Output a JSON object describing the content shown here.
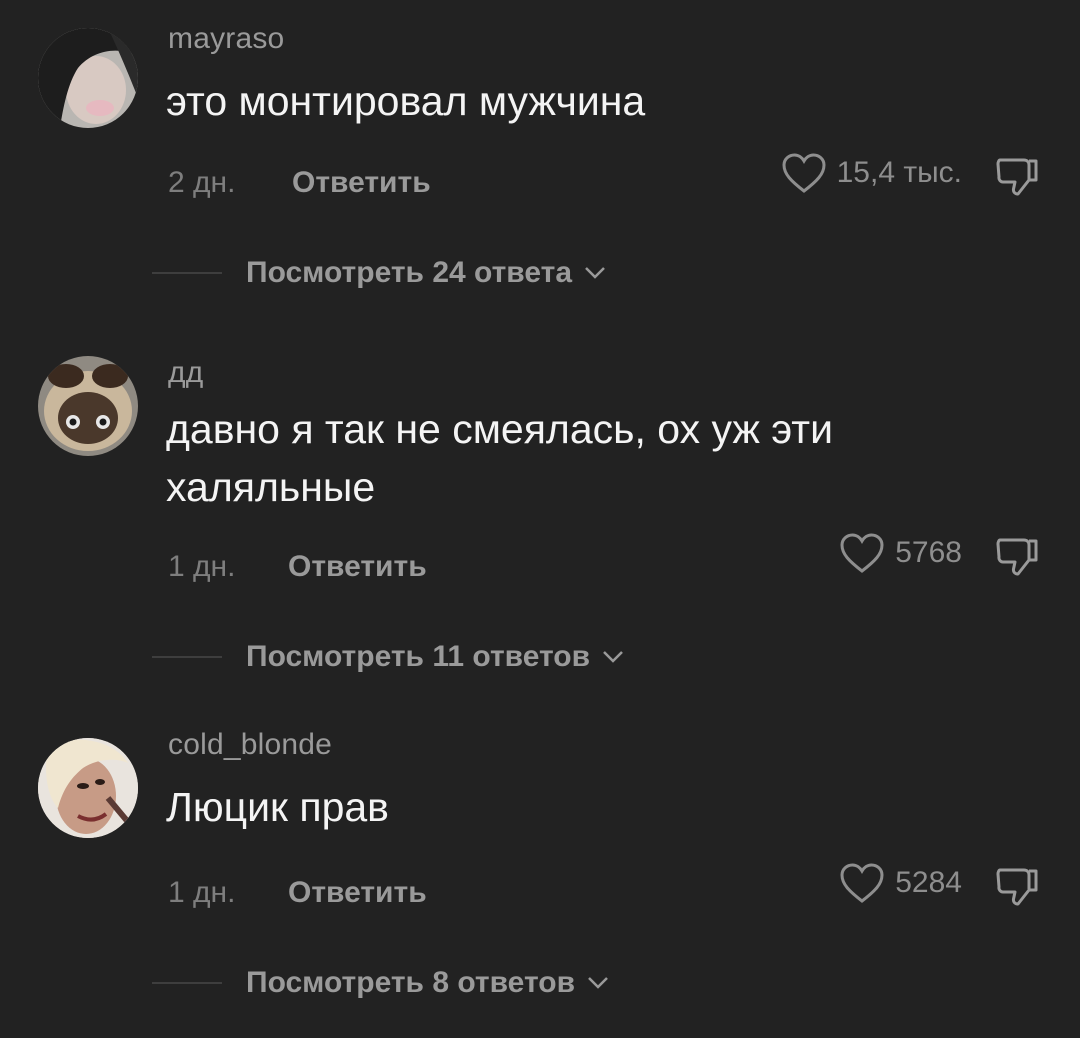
{
  "comments": [
    {
      "username": "mayraso",
      "text": "это монтировал мужчина",
      "time": "2 дн.",
      "reply_label": "Ответить",
      "likes": "15,4 тыс.",
      "view_replies": "Посмотреть 24 ответа"
    },
    {
      "username": "дд",
      "text": "давно я так не смеялась, ох уж эти халяльные",
      "time": "1 дн.",
      "reply_label": "Ответить",
      "likes": "5768",
      "view_replies": "Посмотреть 11 ответов"
    },
    {
      "username": "cold_blonde",
      "text": "Люцик прав",
      "time": "1 дн.",
      "reply_label": "Ответить",
      "likes": "5284",
      "view_replies": "Посмотреть 8 ответов"
    }
  ],
  "icons": {
    "like": "heart-outline-icon",
    "dislike": "thumbs-down-outline-icon",
    "expand": "chevron-down-icon"
  },
  "colors": {
    "background": "#222222",
    "text_primary": "#f4f4f4",
    "text_secondary": "#9a9a9a"
  }
}
